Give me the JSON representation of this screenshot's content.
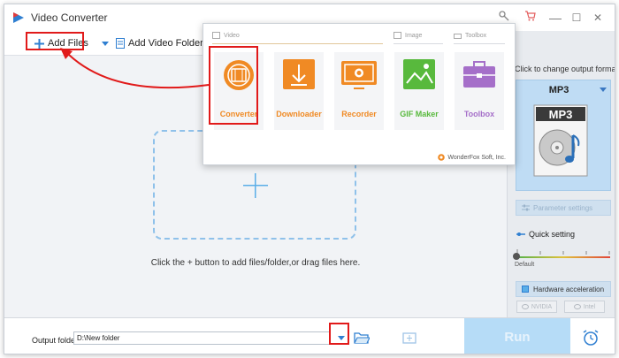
{
  "window": {
    "title": "Video Converter",
    "controls": {
      "minimize": "—",
      "maximize": "☐",
      "close": "✕"
    }
  },
  "toolbar": {
    "add_files": "Add Files",
    "add_video_folder": "Add Video Folder"
  },
  "main": {
    "drop_hint": "Click the + button to add files/folder,or drag files here."
  },
  "popup": {
    "sections": {
      "video": "Video",
      "image": "Image",
      "toolbox": "Toolbox"
    },
    "tiles": [
      {
        "label": "Converter",
        "icon": "film-reel-icon",
        "color": "#f08a24"
      },
      {
        "label": "Downloader",
        "icon": "download-arrow-icon",
        "color": "#f08a24"
      },
      {
        "label": "Recorder",
        "icon": "screen-record-icon",
        "color": "#f08a24"
      },
      {
        "label": "GIF Maker",
        "icon": "landscape-image-icon",
        "color": "#58b93d"
      },
      {
        "label": "Toolbox",
        "icon": "toolbox-briefcase-icon",
        "color": "#a56fc9"
      }
    ],
    "brand": "WonderFox Soft, Inc."
  },
  "right_panel": {
    "title": "Click to change output format:",
    "format": "MP3",
    "parameter_settings": "Parameter settings",
    "quick_setting": "Quick setting",
    "default_label": "Default",
    "hardware_acceleration": "Hardware acceleration",
    "gpu_nvidia": "NVIDIA",
    "gpu_intel": "Intel"
  },
  "bottom": {
    "output_folder_label": "Output folder:",
    "output_folder_value": "D:\\New folder",
    "run": "Run"
  },
  "colors": {
    "accent_blue": "#3a78c2",
    "highlight_red": "#e11a1a",
    "run_disabled": "#b6dcf7"
  }
}
